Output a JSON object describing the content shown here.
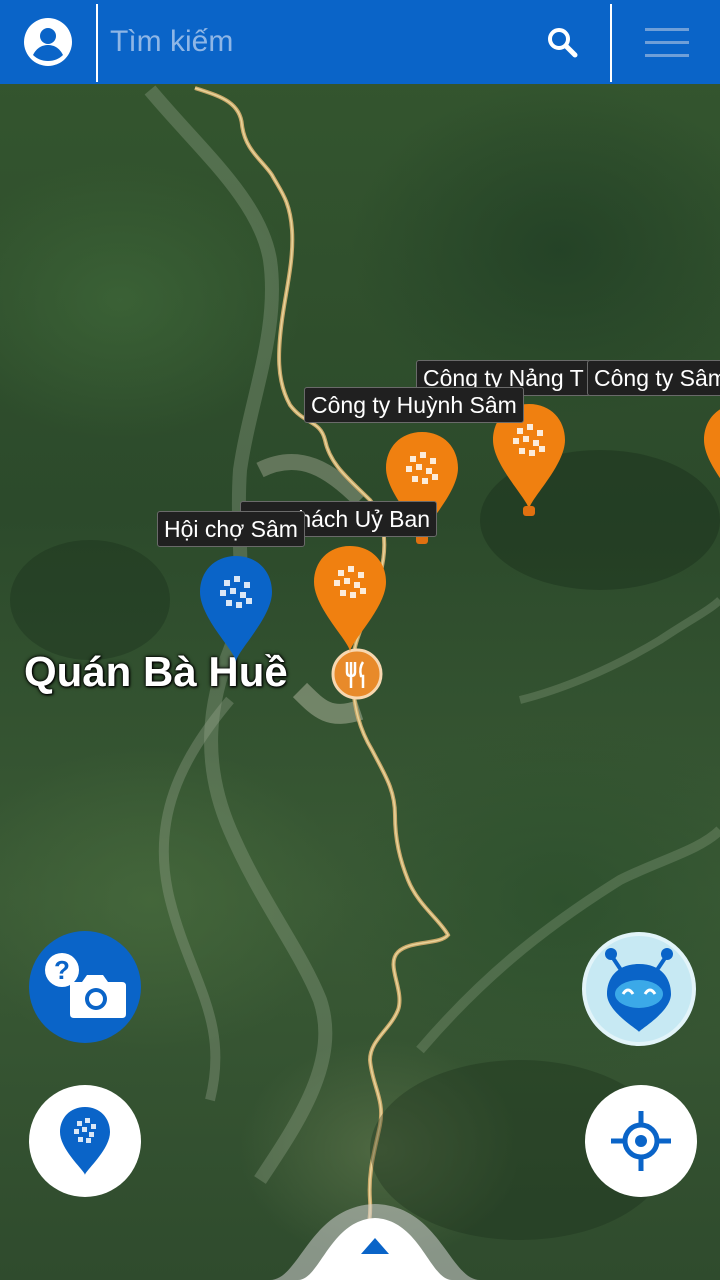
{
  "search": {
    "placeholder": "Tìm kiếm"
  },
  "icons": {
    "account": "account-circle-icon",
    "search": "search-icon",
    "menu": "hamburger-menu-icon",
    "qr_marker": "qr-pattern-icon",
    "restaurant": "fork-knife-icon",
    "camera_help": "question-camera-icon",
    "add_marker": "location-pin-icon",
    "mascot": "blue-robot-mascot-icon",
    "locate": "crosshair-icon",
    "expand": "triangle-up-icon"
  },
  "map": {
    "place_label": "Quán Bà Huề",
    "markers": [
      {
        "label": "Công ty Nảng T",
        "color": "#f08010"
      },
      {
        "label": "Công ty Sâm",
        "color": "#f08010"
      },
      {
        "label": "Công ty Huỳnh Sâm",
        "color": "#f08010"
      },
      {
        "label": "Khách Uỷ Ban",
        "color": "#f08010"
      },
      {
        "label": "Hội chợ Sâm",
        "color": "#0a64c8"
      }
    ]
  },
  "colors": {
    "brand_blue": "#0a64c8",
    "marker_orange": "#f08010",
    "mascot_bg": "#c7e9f3"
  }
}
